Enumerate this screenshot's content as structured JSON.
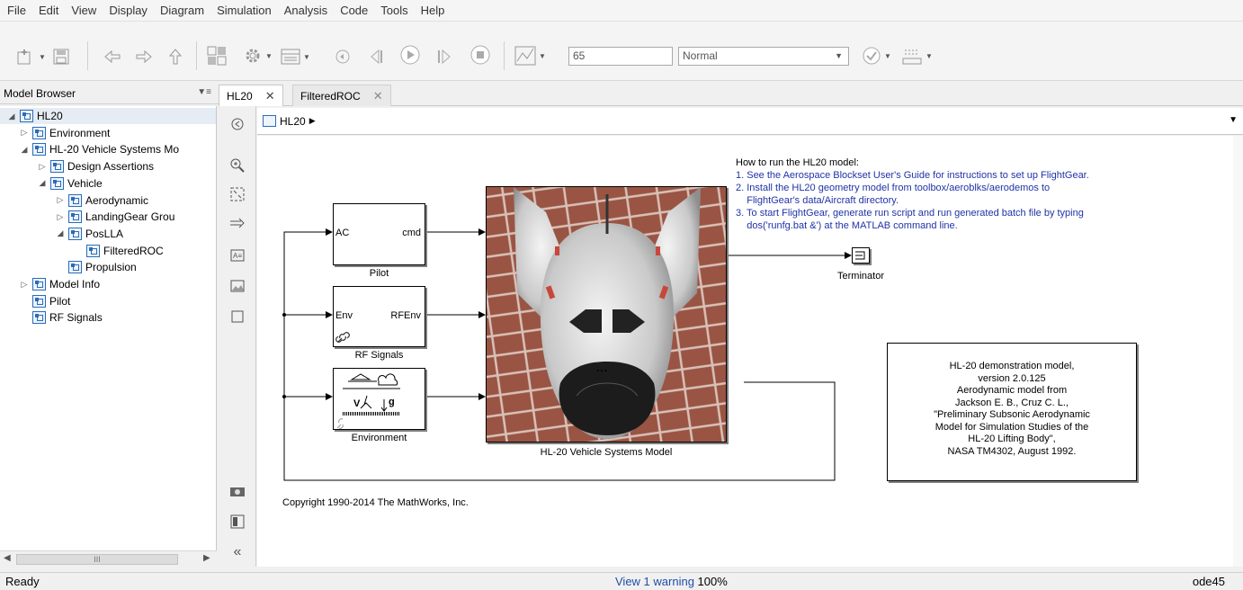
{
  "menu": [
    "File",
    "Edit",
    "View",
    "Display",
    "Diagram",
    "Simulation",
    "Analysis",
    "Code",
    "Tools",
    "Help"
  ],
  "toolbar": {
    "stop_time": "65",
    "sim_mode": "Normal",
    "icons": [
      "new-model-icon",
      "save-icon",
      "back-icon",
      "forward-icon",
      "up-icon",
      "library-browser-icon",
      "model-settings-icon",
      "model-explorer-icon",
      "step-back-icon",
      "run-icon",
      "step-forward-icon",
      "stop-icon",
      "data-inspector-icon",
      "check-icon",
      "build-icon"
    ]
  },
  "browser": {
    "title": "Model Browser",
    "tree": [
      {
        "label": "HL20",
        "level": 0,
        "expanded": true,
        "selected": true
      },
      {
        "label": "Environment",
        "level": 1,
        "expanded": false
      },
      {
        "label": "HL-20 Vehicle Systems Mo",
        "level": 1,
        "expanded": true
      },
      {
        "label": "Design Assertions",
        "level": 2,
        "expanded": false
      },
      {
        "label": "Vehicle",
        "level": 2,
        "expanded": true
      },
      {
        "label": "Aerodynamic",
        "level": 3,
        "expanded": false
      },
      {
        "label": "LandingGear Grou",
        "level": 3,
        "expanded": false
      },
      {
        "label": "PosLLA",
        "level": 3,
        "expanded": true
      },
      {
        "label": "FilteredROC",
        "level": 4,
        "leaf": true
      },
      {
        "label": "Propulsion",
        "level": 3,
        "leaf": true
      },
      {
        "label": "Model Info",
        "level": 1,
        "expanded": false
      },
      {
        "label": "Pilot",
        "level": 1,
        "leaf": true
      },
      {
        "label": "RF Signals",
        "level": 1,
        "leaf": true
      }
    ],
    "scroll_thumb": "III"
  },
  "tabs": [
    {
      "label": "HL20",
      "active": true
    },
    {
      "label": "FilteredROC",
      "active": false
    }
  ],
  "address": {
    "path": "HL20"
  },
  "diagram": {
    "howto_title": "How to run the HL20 model:",
    "howto_steps": [
      "1. See the Aerospace Blockset User's Guide for instructions to set up FlightGear.",
      "2. Install the HL20 geometry model from toolbox/aeroblks/aerodemos to",
      "    FlightGear's data/Aircraft directory.",
      "3. To start FlightGear, generate run script and run generated batch file by typing",
      "    dos('runfg.bat &') at the MATLAB command line."
    ],
    "pilot": {
      "in": "AC",
      "out": "cmd",
      "name": "Pilot"
    },
    "rf": {
      "in": "Env",
      "out": "RFEnv",
      "name": "RF Signals"
    },
    "env": {
      "name": "Environment",
      "v_label": "V",
      "g_label": "g"
    },
    "vehicle": {
      "name": "HL-20 Vehicle Systems Model",
      "dots": "..."
    },
    "terminator": {
      "name": "Terminator"
    },
    "info_lines": [
      "HL-20 demonstration model,",
      "version 2.0.125",
      "Aerodynamic model from",
      "Jackson E. B., Cruz C. L.,",
      "\"Preliminary Subsonic Aerodynamic",
      "Model for Simulation Studies of the",
      "HL-20 Lifting Body\",",
      "NASA TM4302, August 1992."
    ],
    "copyright": "Copyright 1990-2014 The MathWorks, Inc."
  },
  "status": {
    "left": "Ready",
    "warning": "View 1 warning",
    "zoom": "100%",
    "solver": "ode45"
  },
  "colors": {
    "link_blue": "#1f33a8",
    "block_shadow": "#7f7f7f"
  }
}
